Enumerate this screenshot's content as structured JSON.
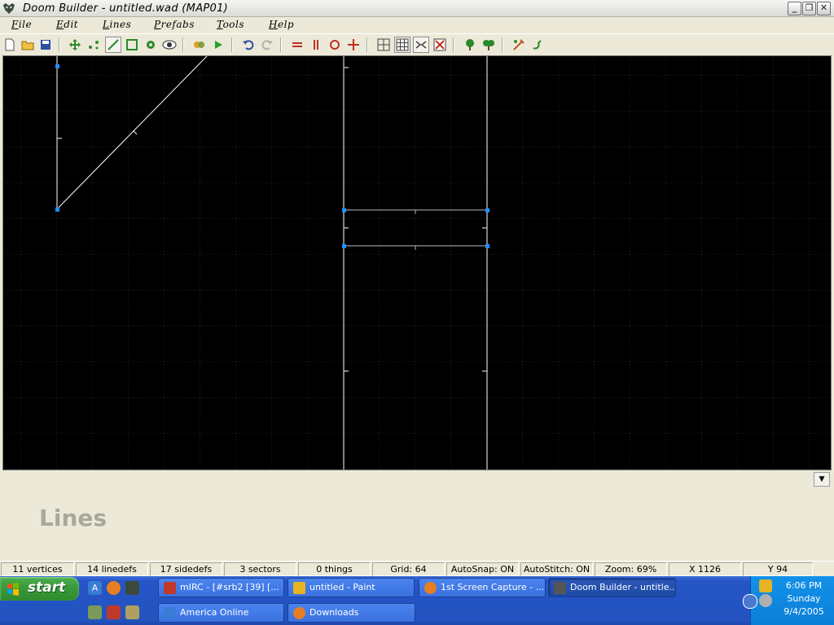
{
  "window": {
    "title": "Doom Builder - untitled.wad (MAP01)",
    "min_label": "_",
    "max_label": "❐",
    "close_label": "✕"
  },
  "menu": {
    "items": [
      {
        "mnemonic": "F",
        "rest": "ile"
      },
      {
        "mnemonic": "E",
        "rest": "dit"
      },
      {
        "mnemonic": "L",
        "rest": "ines"
      },
      {
        "mnemonic": "P",
        "rest": "refabs"
      },
      {
        "mnemonic": "T",
        "rest": "ools"
      },
      {
        "mnemonic": "H",
        "rest": "elp"
      }
    ]
  },
  "toolbar": {
    "icons": [
      "new-file-icon",
      "open-folder-icon",
      "save-icon",
      "move-mode-icon",
      "vertices-mode-icon",
      "lines-mode-icon",
      "sectors-mode-icon",
      "things-mode-icon",
      "3d-mode-icon",
      "test-map-icon",
      "play-icon",
      "undo-icon",
      "redo-icon",
      "flip-lines-icon",
      "flip-vertical-icon",
      "rotate-icon",
      "scale-icon",
      "grid-icon",
      "snap-grid-icon",
      "stitch-icon",
      "delete-icon",
      "tree-icon",
      "tree2-icon",
      "tools-icon",
      "script-icon"
    ]
  },
  "editor": {
    "mode_label": "Lines",
    "colors": {
      "background": "#000000",
      "grid": "#2a2a2a",
      "lines": "#ffffff",
      "vertex": "#1e90ff"
    }
  },
  "status": {
    "vertices": "11 vertices",
    "linedefs": "14 linedefs",
    "sidedefs": "17 sidedefs",
    "sectors": "3 sectors",
    "things": "0 things",
    "grid": "Grid: 64",
    "autosnap": "AutoSnap: ON",
    "autostitch": "AutoStitch: ON",
    "zoom": "Zoom: 69%",
    "x": "X 1126",
    "y": "Y 94"
  },
  "taskbar": {
    "start_label": "start",
    "tasks_row1": [
      {
        "label": "mIRC - [#srb2 [39] [...",
        "color": "#c0392b"
      },
      {
        "label": "untitled - Paint",
        "color": "#e6b422"
      },
      {
        "label": "1st Screen Capture - ...",
        "color": "#e67e22"
      },
      {
        "label": "Doom Builder - untitle...",
        "color": "#555555"
      }
    ],
    "tasks_row2": [
      {
        "label": "America  Online",
        "color": "#3a7bd5"
      },
      {
        "label": "Downloads",
        "color": "#e67e22"
      }
    ],
    "clock": {
      "time": "6:06 PM",
      "day": "Sunday",
      "date": "9/4/2005"
    }
  }
}
